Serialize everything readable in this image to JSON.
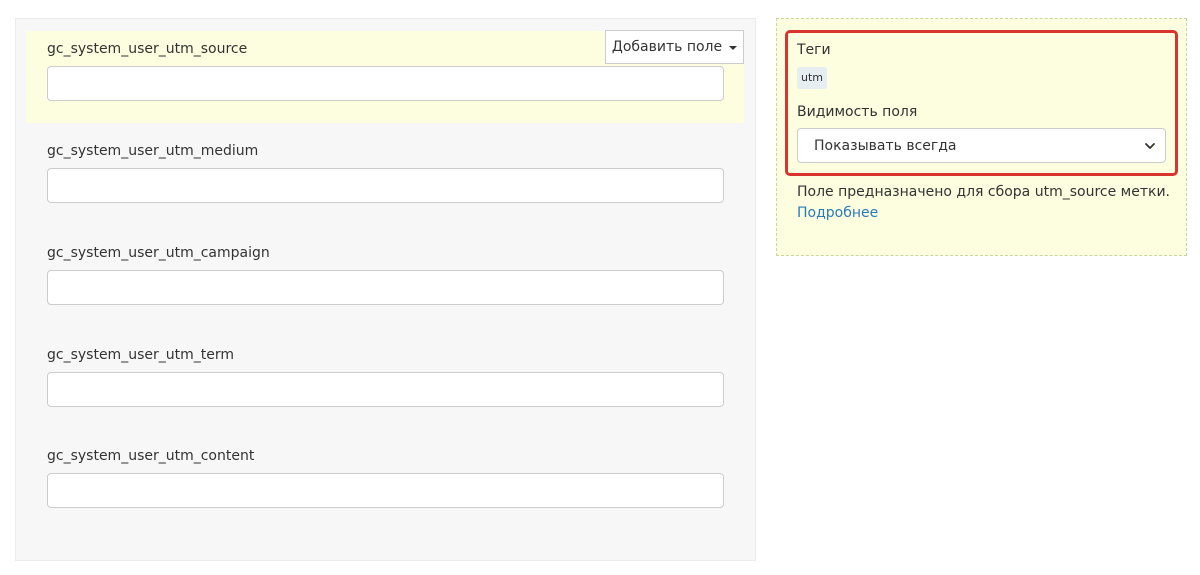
{
  "fields": [
    {
      "label": "gc_system_user_utm_source",
      "value": ""
    },
    {
      "label": "gc_system_user_utm_medium",
      "value": ""
    },
    {
      "label": "gc_system_user_utm_campaign",
      "value": ""
    },
    {
      "label": "gc_system_user_utm_term",
      "value": ""
    },
    {
      "label": "gc_system_user_utm_content",
      "value": ""
    }
  ],
  "toolbar": {
    "add_field_label": "Добавить поле"
  },
  "side_panel": {
    "tags_label": "Теги",
    "tag": "utm",
    "visibility_label": "Видимость поля",
    "visibility_value": "Показывать всегда",
    "description": "Поле предназначено для сбора utm_source метки.",
    "more_link": "Подробнее"
  },
  "colors": {
    "highlight_background": "#fdfde0",
    "frame_border": "#d9352f",
    "link": "#2a7ab8"
  }
}
